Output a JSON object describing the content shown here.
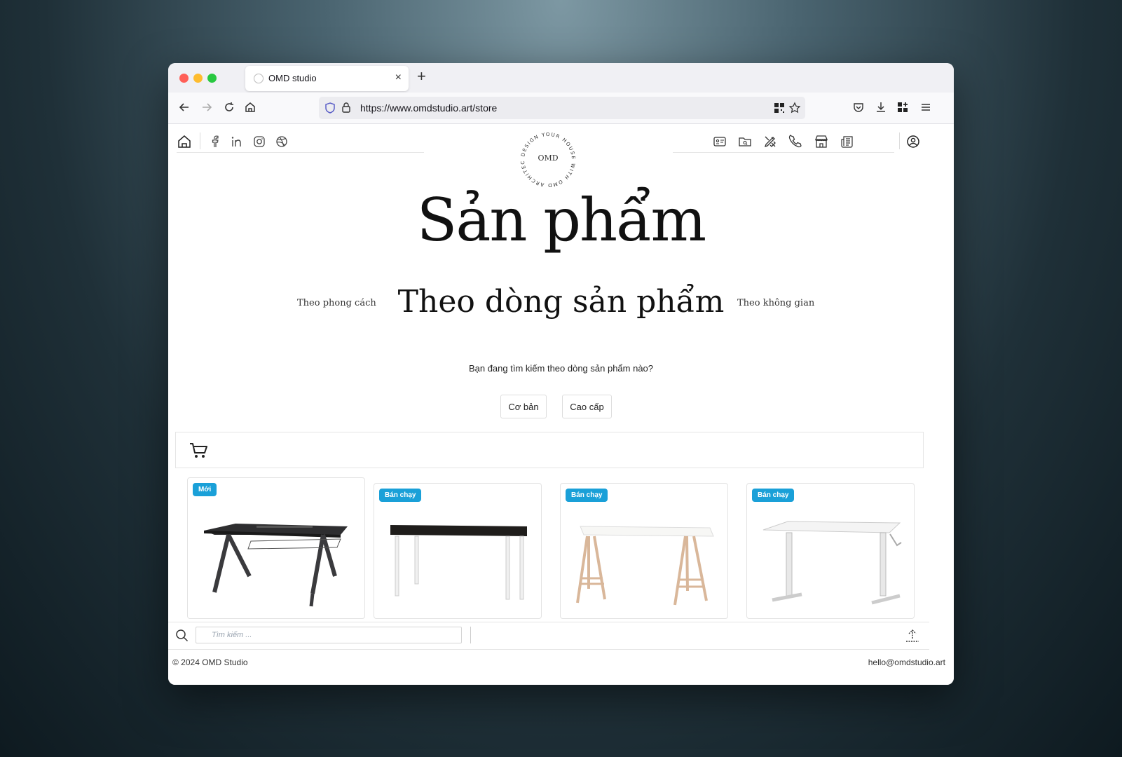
{
  "browser": {
    "tab_title": "OMD studio",
    "url": "https://www.omdstudio.art/store",
    "new_tab_label": "+",
    "close_tab_label": "×"
  },
  "logo": {
    "text": "OMD",
    "ring_text": "DESIGN YOUR HOUSE WITH OMD ARCHITECT"
  },
  "hero": {
    "title": "Sản phẩm"
  },
  "categories": {
    "left": "Theo phong cách",
    "active": "Theo dòng sản phẩm",
    "right": "Theo không gian"
  },
  "filter": {
    "question": "Bạn đang tìm kiếm theo dòng sản phẩm nào?",
    "options": [
      "Cơ bản",
      "Cao cấp"
    ]
  },
  "products": [
    {
      "badge": "Mới",
      "image": "black-gaming-desk"
    },
    {
      "badge": "Bán chạy",
      "image": "black-top-white-leg-desk"
    },
    {
      "badge": "Bán chạy",
      "image": "trestle-desk"
    },
    {
      "badge": "Bán chạy",
      "image": "white-crank-desk"
    }
  ],
  "search": {
    "placeholder": "Tìm kiếm ..."
  },
  "footer": {
    "copyright": "© 2024 OMD Studio",
    "email": "hello@omdstudio.art"
  },
  "colors": {
    "badge": "#1aa0d8",
    "close": "#ff5f57",
    "minimize": "#febc2e",
    "maximize": "#28c840"
  },
  "icons": {
    "social": [
      "facebook-icon",
      "linkedin-icon",
      "instagram-icon",
      "dribbble-icon"
    ],
    "site_nav": [
      "contact-card-icon",
      "folder-search-icon",
      "design-tools-icon",
      "phone-icon",
      "store-icon",
      "newspaper-icon"
    ]
  }
}
